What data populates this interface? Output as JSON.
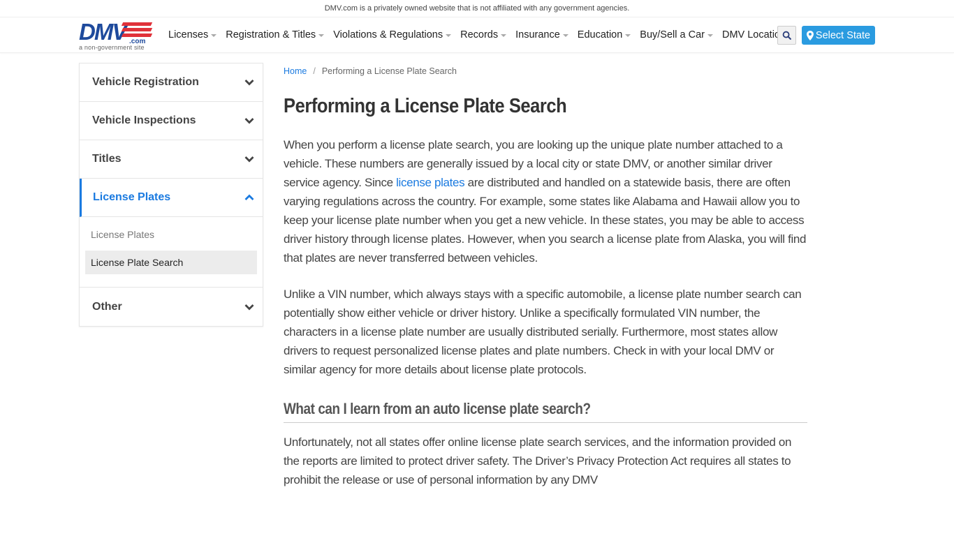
{
  "topbar": {
    "disclaimer": "DMV.com is a privately owned website that is not affiliated with any government agencies."
  },
  "logo": {
    "main": "DMV",
    "suffix": ".com",
    "tagline": "a non-government site"
  },
  "nav": {
    "items": [
      {
        "label": "Licenses",
        "dropdown": true
      },
      {
        "label": "Registration & Titles",
        "dropdown": true
      },
      {
        "label": "Violations & Regulations",
        "dropdown": true
      },
      {
        "label": "Records",
        "dropdown": true
      },
      {
        "label": "Insurance",
        "dropdown": true
      },
      {
        "label": "Education",
        "dropdown": true
      },
      {
        "label": "Buy/Sell a Car",
        "dropdown": true
      },
      {
        "label": "DMV Locations",
        "dropdown": false
      }
    ],
    "search_icon": "search-icon",
    "select_state_label": "Select State",
    "select_state_icon": "map-marker-icon"
  },
  "colors": {
    "brand_blue": "#1e4a9c",
    "brand_red": "#e0323a",
    "accent": "#2a9be0",
    "link": "#1a7ae0"
  },
  "sidebar": {
    "items": [
      {
        "label": "Vehicle Registration",
        "expanded": false
      },
      {
        "label": "Vehicle Inspections",
        "expanded": false
      },
      {
        "label": "Titles",
        "expanded": false
      },
      {
        "label": "License Plates",
        "expanded": true
      },
      {
        "label": "Other",
        "expanded": false
      }
    ],
    "sub_items": [
      {
        "label": "License Plates",
        "selected": false
      },
      {
        "label": "License Plate Search",
        "selected": true
      }
    ]
  },
  "breadcrumb": {
    "home": "Home",
    "separator": "/",
    "current": "Performing a License Plate Search"
  },
  "article": {
    "title": "Performing a License Plate Search",
    "p1_before": "When you perform a license plate search, you are looking up the unique plate number attached to a vehicle. These numbers are generally issued by a local city or state DMV, or another similar driver service agency. Since ",
    "p1_link": "license plates",
    "p1_after": " are distributed and handled on a statewide basis, there are often varying regulations across the country. For example, some states like Alabama and Hawaii allow you to keep your license plate number when you get a new vehicle. In these states, you may be able to access driver history through license plates. However, when you search a license plate from Alaska, you will find that plates are never transferred between vehicles.",
    "p2": "Unlike a VIN number, which always stays with a specific automobile, a license plate number search can potentially show either vehicle or driver history. Unlike a specifically formulated VIN number, the characters in a license plate number are usually distributed serially. Furthermore, most states allow drivers to request personalized license plates and plate numbers. Check in with your local DMV or similar agency for more details about license plate protocols.",
    "h2": "What can I learn from an auto license plate search?",
    "p3": "Unfortunately, not all states offer online license plate search services, and the information provided on the reports are limited to protect driver safety. The Driver’s Privacy Protection Act requires all states to prohibit the release or use of personal information by any DMV"
  }
}
